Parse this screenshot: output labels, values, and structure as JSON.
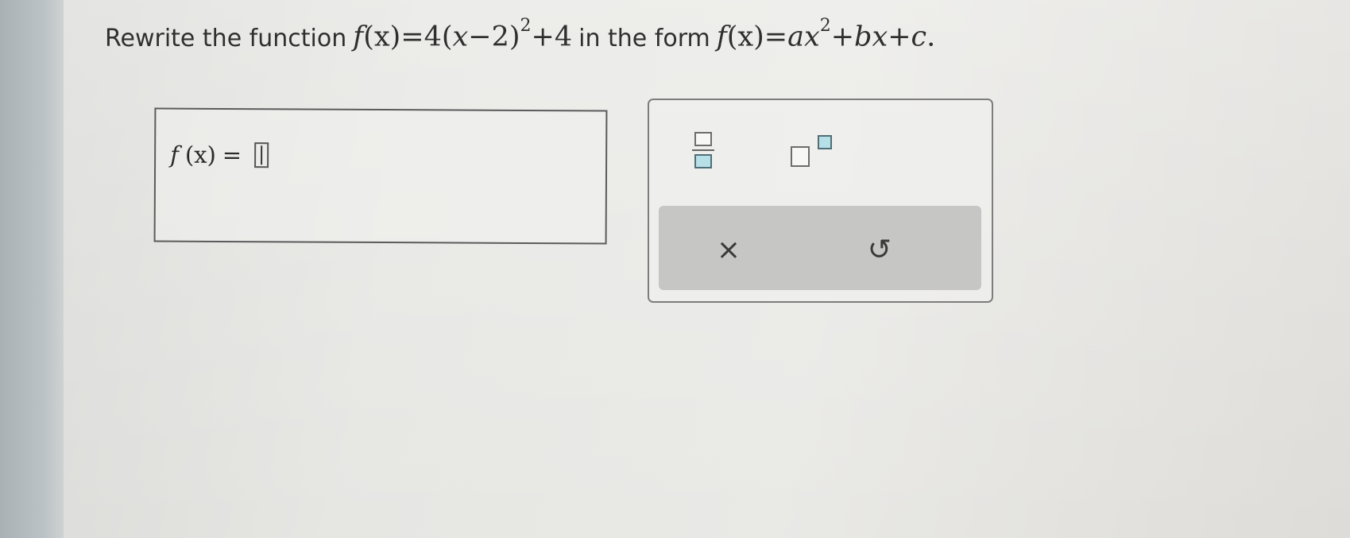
{
  "question": {
    "prefix": "Rewrite the function",
    "given_f": "f",
    "given_x": "(x)",
    "given_rhs": "=4(",
    "given_x2": "x",
    "given_rest": "−2)",
    "given_exp": "2",
    "given_tail": "+4",
    "middle": "in the form",
    "form_f": "f",
    "form_x": "(x)",
    "form_eq": "=",
    "form_a": "a",
    "form_x2": "x",
    "form_exp": "2",
    "form_plus1": "+",
    "form_b": "b",
    "form_x3": "x",
    "form_plus2": "+",
    "form_c": "c",
    "form_end": "."
  },
  "answer": {
    "f_label": "f",
    "x_label": "(x)",
    "equals": "=",
    "value": ""
  },
  "toolbar": {
    "fraction_tool": "fraction-icon",
    "power_tool": "exponent-icon",
    "clear_symbol": "×",
    "undo_symbol": "↺"
  },
  "colors": {
    "slot_highlight": "#b7dfe8",
    "panel_border": "#7d7d7d",
    "action_bar": "#c6c6c4"
  }
}
